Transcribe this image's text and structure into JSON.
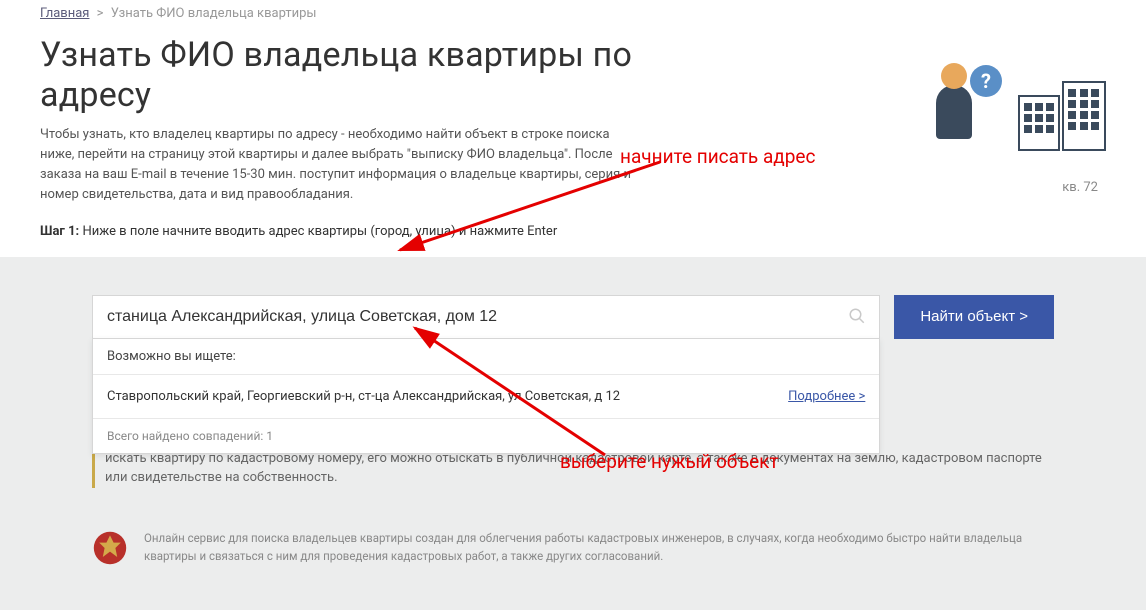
{
  "breadcrumbs": {
    "home": "Главная",
    "current": "Узнать ФИО владельца квартиры"
  },
  "page_title": "Узнать ФИО владельца квартиры по адресу",
  "intro": "Чтобы узнать, кто владелец квартиры по адресу - необходимо найти объект в строке поиска ниже, перейти на страницу этой квартиры и далее выбрать \"выписку ФИО владельца\". После заказа на ваш E-mail в течение 15-30 мин. поступит информация о владельце квартиры, серия и номер свидетельства, дата и вид правообладания.",
  "step1_label": "Шаг 1:",
  "step1_text": "Ниже в поле начните вводить адрес квартиры (город, улица) и нажмите Enter",
  "illustration": {
    "question": "?",
    "apt_label": "кв. 72"
  },
  "search": {
    "value": "станица Александрийская, улица Советская, дом 12",
    "button": "Найти объект >"
  },
  "dropdown": {
    "header": "Возможно вы ищете:",
    "item_text": "Ставропольский край, Георгиевский р-н, ст-ца Александрийская, ул Советская, д 12",
    "item_link": "Подробнее >",
    "footer_prefix": "Всего найдено совпадений: ",
    "footer_count": "1"
  },
  "below": "искать квартиру по кадастровому номеру, его можно отыскать в публичной кадастровой карте, а так же в документах на землю, кадастровом паспорте или свидетельстве на собственность.",
  "footer": "Онлайн сервис для поиска владельцев квартиры создан для облегчения работы кадастровых инженеров, в случаях, когда необходимо быстро найти владельца квартиры и связаться с ним для проведения кадастровых работ, а также других согласований.",
  "annotations": {
    "start_typing": "начните писать адрес",
    "select_object": "выберите нужый объект"
  }
}
